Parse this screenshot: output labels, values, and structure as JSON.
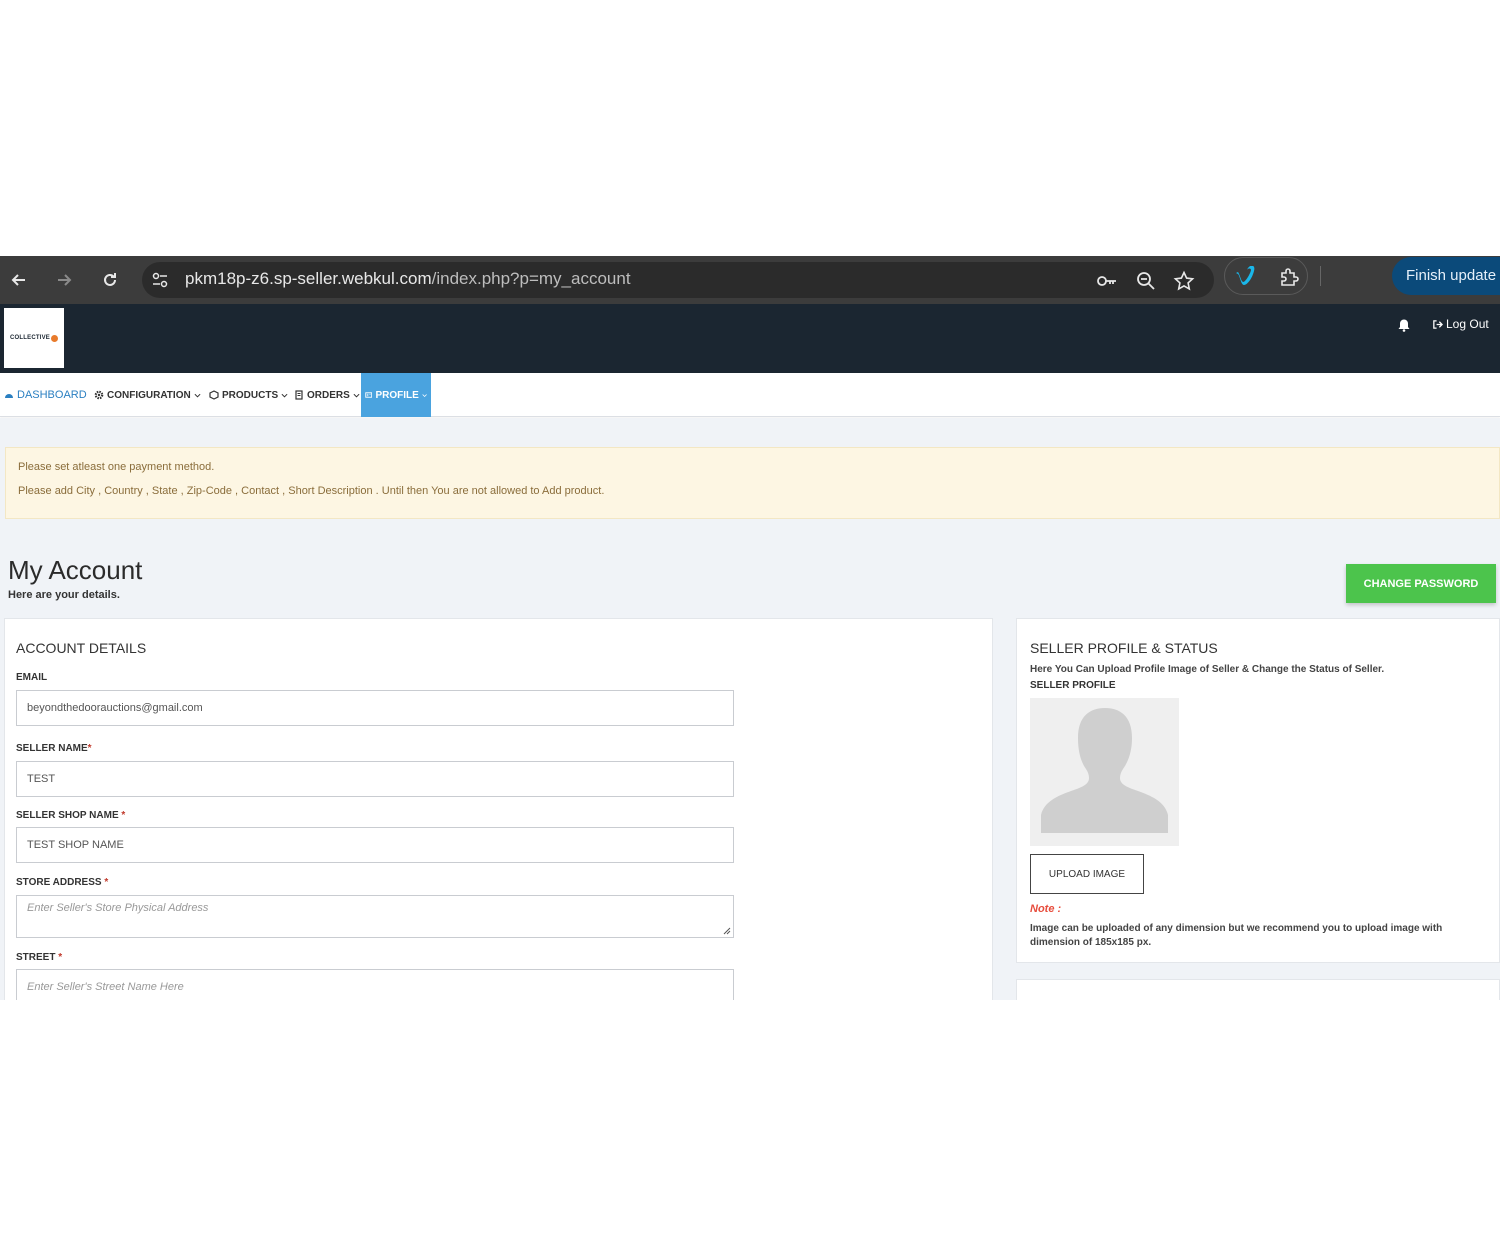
{
  "browser": {
    "url_host": "pkm18p-z6.sp-seller.webkul.com",
    "url_path": "/index.php?p=my_account",
    "finish_update_label": "Finish update"
  },
  "header": {
    "logo_text": "COLLECTIVE",
    "logout_label": "Log Out"
  },
  "menu": {
    "items": [
      {
        "label": "DASHBOARD",
        "icon": "dashboard-icon"
      },
      {
        "label": "CONFIGURATION",
        "icon": "gear-icon"
      },
      {
        "label": "PRODUCTS",
        "icon": "product-icon"
      },
      {
        "label": "ORDERS",
        "icon": "orders-icon"
      },
      {
        "label": "PROFILE",
        "icon": "profile-icon",
        "active": true
      }
    ]
  },
  "alert": {
    "line1": "Please set atleast one payment method.",
    "line2": "Please add City , Country , State , Zip-Code , Contact , Short Description . Until then You are not allowed to Add product."
  },
  "page": {
    "title": "My Account",
    "subtitle": "Here are your details.",
    "change_password_label": "CHANGE PASSWORD"
  },
  "account": {
    "title": "ACCOUNT DETAILS",
    "email_label": "EMAIL",
    "email_value": "beyondthedoorauctions@gmail.com",
    "seller_name_label": "SELLER NAME",
    "seller_name_value": "TEST",
    "shop_name_label": "SELLER SHOP NAME ",
    "shop_name_value": "TEST SHOP NAME",
    "store_address_label": "STORE ADDRESS ",
    "store_address_placeholder": "Enter Seller's Store Physical Address",
    "street_label": "STREET ",
    "street_placeholder": "Enter Seller's Street Name Here",
    "required_mark": "*"
  },
  "profile": {
    "title": "SELLER PROFILE & STATUS",
    "description": "Here You Can Upload Profile Image of Seller & Change the Status of Seller.",
    "seller_profile_label": "SELLER PROFILE",
    "upload_label": "UPLOAD IMAGE",
    "note_label": "Note :",
    "note_text": "Image can be uploaded of any dimension but we recommend you to upload image with dimension of 185x185 px."
  },
  "colors": {
    "header_bg": "#1b2631",
    "active_menu": "#4aa3df",
    "change_password": "#4cc44c",
    "alert_bg": "#fdf6e3",
    "note_red": "#e74c3c"
  }
}
